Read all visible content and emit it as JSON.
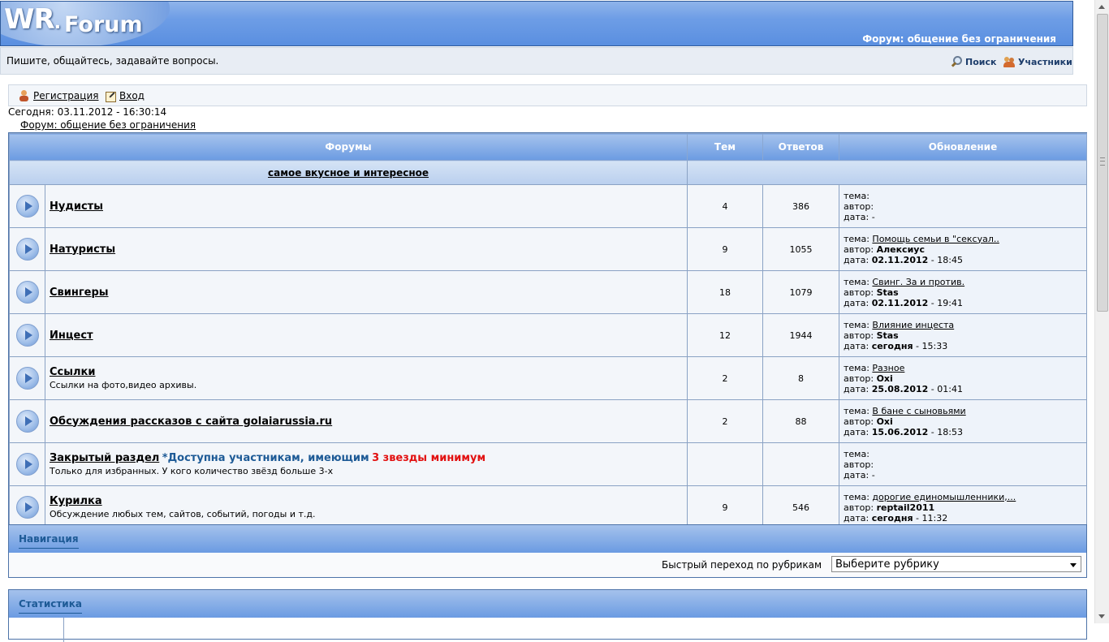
{
  "header": {
    "logo_wr": "WR",
    "logo_dot": ".",
    "logo_forum": "Forum",
    "subtitle": "Форум: общение без ограничения"
  },
  "tagline_bar": {
    "tagline": "Пишите, общайтесь, задавайте вопросы.",
    "search_label": "Поиск",
    "members_label": "Участники"
  },
  "login_bar": {
    "register_label": "Регистрация",
    "login_label": "Вход"
  },
  "today": "Сегодня: 03.11.2012 - 16:30:14",
  "breadcrumb": "Форум: общение без ограничения",
  "forums_table": {
    "columns": [
      "Форумы",
      "Тем",
      "Ответов",
      "Обновление"
    ],
    "category": "самое вкусное и интересное",
    "update_labels": {
      "topic": "тема:",
      "author": "автор:",
      "date": "дата:"
    },
    "rows": [
      {
        "name": "Нудисты",
        "description": "",
        "topics": "4",
        "replies": "386",
        "last_topic": "",
        "last_author": "",
        "last_date_bold": "",
        "last_time": "-"
      },
      {
        "name": "Натуристы",
        "description": "",
        "topics": "9",
        "replies": "1055",
        "last_topic": "Помощь семьи в \"сексуал..",
        "last_author": "Алексиус",
        "last_date_bold": "02.11.2012",
        "last_time": " - 18:45"
      },
      {
        "name": "Свингеры",
        "description": "",
        "topics": "18",
        "replies": "1079",
        "last_topic": "Свинг. За и против.",
        "last_author": "Stas",
        "last_date_bold": "02.11.2012",
        "last_time": " - 19:41"
      },
      {
        "name": "Инцест",
        "description": "",
        "topics": "12",
        "replies": "1944",
        "last_topic": "Влияние инцеста",
        "last_author": "Stas",
        "last_date_bold": "сегодня",
        "last_time": " - 15:33"
      },
      {
        "name": "Ссылки",
        "description": "Ссылки на фото,видео архивы.",
        "topics": "2",
        "replies": "8",
        "last_topic": "Разное",
        "last_author": "Oxi",
        "last_date_bold": "25.08.2012",
        "last_time": " - 01:41"
      },
      {
        "name": "Обсуждения рассказов с сайта golaiarussia.ru",
        "description": "",
        "topics": "2",
        "replies": "88",
        "last_topic": "В бане с сыновьями",
        "last_author": "Oxi",
        "last_date_bold": "15.06.2012",
        "last_time": " - 18:53"
      },
      {
        "name": "Закрытый раздел",
        "restriction_blue": "*Доступна участникам, имеющим",
        "restriction_red": "3 звезды минимум",
        "description": "Только для избранных. У кого количество звёзд больше 3-х",
        "topics": "",
        "replies": "",
        "last_topic": "",
        "last_author": "",
        "last_date_bold": "",
        "last_time": "-"
      },
      {
        "name": "Курилка",
        "description": "Обсуждение любых тем, сайтов, событий, погоды и т.д.",
        "topics": "9",
        "replies": "546",
        "last_topic": "дорогие единомышленники,...",
        "last_author": "reptail2011",
        "last_date_bold": "сегодня",
        "last_time": " - 11:32"
      }
    ]
  },
  "navigation": {
    "title": "Навигация",
    "jump_label": "Быстрый переход по рубрикам",
    "jump_selected": "Выберите рубрику"
  },
  "statistics": {
    "title": "Статистика"
  }
}
